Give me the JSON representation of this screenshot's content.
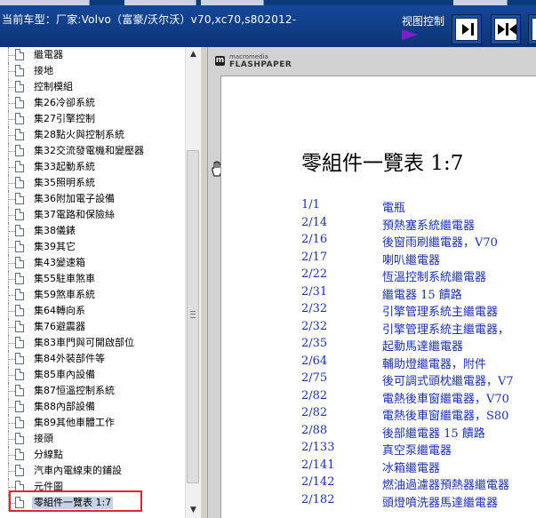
{
  "header": {
    "title": "当前车型：厂家:Volvo（富豪/沃尔沃）v70,xc70,s802012-",
    "view_control_label": "视图控制"
  },
  "tree": {
    "items": [
      {
        "label": "繼電器",
        "selected": false
      },
      {
        "label": "接地",
        "selected": false
      },
      {
        "label": "控制模組",
        "selected": false
      },
      {
        "label": "集26冷卻系統",
        "selected": false
      },
      {
        "label": "集27引擎控制",
        "selected": false
      },
      {
        "label": "集28點火與控制系統",
        "selected": false
      },
      {
        "label": "集32交流發電機和變壓器",
        "selected": false
      },
      {
        "label": "集33起動系統",
        "selected": false
      },
      {
        "label": "集35照明系統",
        "selected": false
      },
      {
        "label": "集36附加電子設備",
        "selected": false
      },
      {
        "label": "集37電路和保險絲",
        "selected": false
      },
      {
        "label": "集38儀錶",
        "selected": false
      },
      {
        "label": "集39其它",
        "selected": false
      },
      {
        "label": "集43變速箱",
        "selected": false
      },
      {
        "label": "集55駐車煞車",
        "selected": false
      },
      {
        "label": "集59煞車系統",
        "selected": false
      },
      {
        "label": "集64轉向系",
        "selected": false
      },
      {
        "label": "集76避震器",
        "selected": false
      },
      {
        "label": "集83車門與可開啟部位",
        "selected": false
      },
      {
        "label": "集84外裝部件等",
        "selected": false
      },
      {
        "label": "集85車內設備",
        "selected": false
      },
      {
        "label": "集87恒溫控制系統",
        "selected": false
      },
      {
        "label": "集88內部設備",
        "selected": false
      },
      {
        "label": "集89其他車體工作",
        "selected": false
      },
      {
        "label": "接頭",
        "selected": false
      },
      {
        "label": "分線點",
        "selected": false
      },
      {
        "label": "汽車內電線束的鋪設",
        "selected": false
      },
      {
        "label": "元件圖",
        "selected": false
      },
      {
        "label": "零組件一覽表 1:7",
        "selected": true
      }
    ]
  },
  "viewer": {
    "logo_small": "macromedia",
    "logo_big": "FLASHPAPER",
    "page_title": "零組件一覽表 1:7",
    "rows": [
      {
        "num": "1/1",
        "text": "電瓶"
      },
      {
        "num": "2/14",
        "text": "預熱塞系統繼電器"
      },
      {
        "num": "2/16",
        "text": "後窗雨刷繼電器，V70"
      },
      {
        "num": "2/17",
        "text": "喇叭繼電器"
      },
      {
        "num": "2/22",
        "text": "恆溫控制系統繼電器"
      },
      {
        "num": "2/31",
        "text": "繼電器 15 饋路"
      },
      {
        "num": "2/32",
        "text": "引擎管理系統主繼電器"
      },
      {
        "num": "2/32",
        "text": "引擎管理系統主繼電器，"
      },
      {
        "num": "2/35",
        "text": "起動馬達繼電器"
      },
      {
        "num": "2/64",
        "text": "輔助燈繼電器，附件"
      },
      {
        "num": "2/75",
        "text": "後可調式頭枕繼電器，V7"
      },
      {
        "num": "2/82",
        "text": "電熱後車窗繼電器，V70"
      },
      {
        "num": "2/82",
        "text": "電熱後車窗繼電器，S80"
      },
      {
        "num": "2/88",
        "text": "後部繼電器 15 饋路"
      },
      {
        "num": "2/133",
        "text": "真空泵繼電器"
      },
      {
        "num": "2/141",
        "text": "冰箱繼電器"
      },
      {
        "num": "2/142",
        "text": "燃油過濾器預熱器繼電器"
      },
      {
        "num": "2/182",
        "text": "頭燈噴洗器馬達繼電器"
      }
    ]
  },
  "colors": {
    "header_bg": "#14489a",
    "link_text": "#1a2fbe",
    "selection_outline": "#e0262b",
    "view_arrow": "#7d1fd0"
  },
  "icons": {
    "tree_item": "document-icon",
    "view_buttons": [
      "arrow-right-bar-icon",
      "arrows-inward-bar-icon",
      "arrow-left-bar-icon"
    ]
  }
}
